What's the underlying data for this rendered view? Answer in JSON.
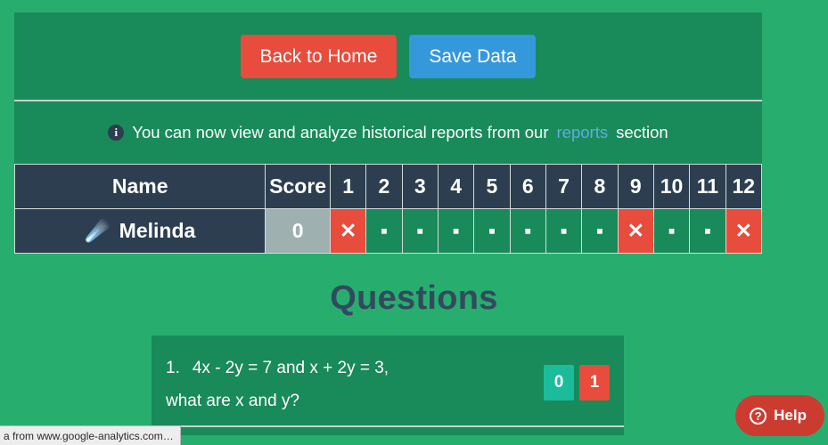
{
  "toolbar": {
    "back_label": "Back to Home",
    "save_label": "Save Data"
  },
  "alert": {
    "icon": "info-icon",
    "text_before": "You can now view and analyze historical reports from our",
    "link_text": "reports",
    "text_after": "section"
  },
  "table": {
    "headers": {
      "name": "Name",
      "score": "Score",
      "questions": [
        "1",
        "2",
        "3",
        "4",
        "5",
        "6",
        "7",
        "8",
        "9",
        "10",
        "11",
        "12"
      ]
    },
    "row": {
      "avatar": "comet-emoji",
      "avatar_glyph": "☄️",
      "name": "Melinda",
      "score": "0",
      "cells": [
        {
          "state": "wrong",
          "mark": "✕"
        },
        {
          "state": "empty",
          "mark": "▪"
        },
        {
          "state": "empty",
          "mark": "▪"
        },
        {
          "state": "empty",
          "mark": "▪"
        },
        {
          "state": "empty",
          "mark": "▪"
        },
        {
          "state": "empty",
          "mark": "▪"
        },
        {
          "state": "empty",
          "mark": "▪"
        },
        {
          "state": "empty",
          "mark": "▪"
        },
        {
          "state": "wrong",
          "mark": "✕"
        },
        {
          "state": "empty",
          "mark": "▪"
        },
        {
          "state": "empty",
          "mark": "▪"
        },
        {
          "state": "wrong",
          "mark": "✕"
        }
      ]
    }
  },
  "questions_section": {
    "title": "Questions",
    "items": [
      {
        "number": "1.",
        "line1": "4x - 2y = 7 and x + 2y = 3,",
        "line2": "what are x and y?",
        "score_zero": "0",
        "score_one": "1"
      }
    ]
  },
  "help": {
    "icon": "question-circle-icon",
    "icon_glyph": "?",
    "label": "Help"
  },
  "status_bar": {
    "text": "a from www.google-analytics.com…"
  },
  "colors": {
    "page_bg": "#27ae6e",
    "panel_bg": "#198a5a",
    "header_bg": "#2c3e50",
    "danger": "#e74c3c",
    "info": "#3498db",
    "teal": "#1abc9c",
    "score_cell": "#9fb0b1",
    "link": "#5dade2",
    "help_bg": "#cc3b30"
  }
}
